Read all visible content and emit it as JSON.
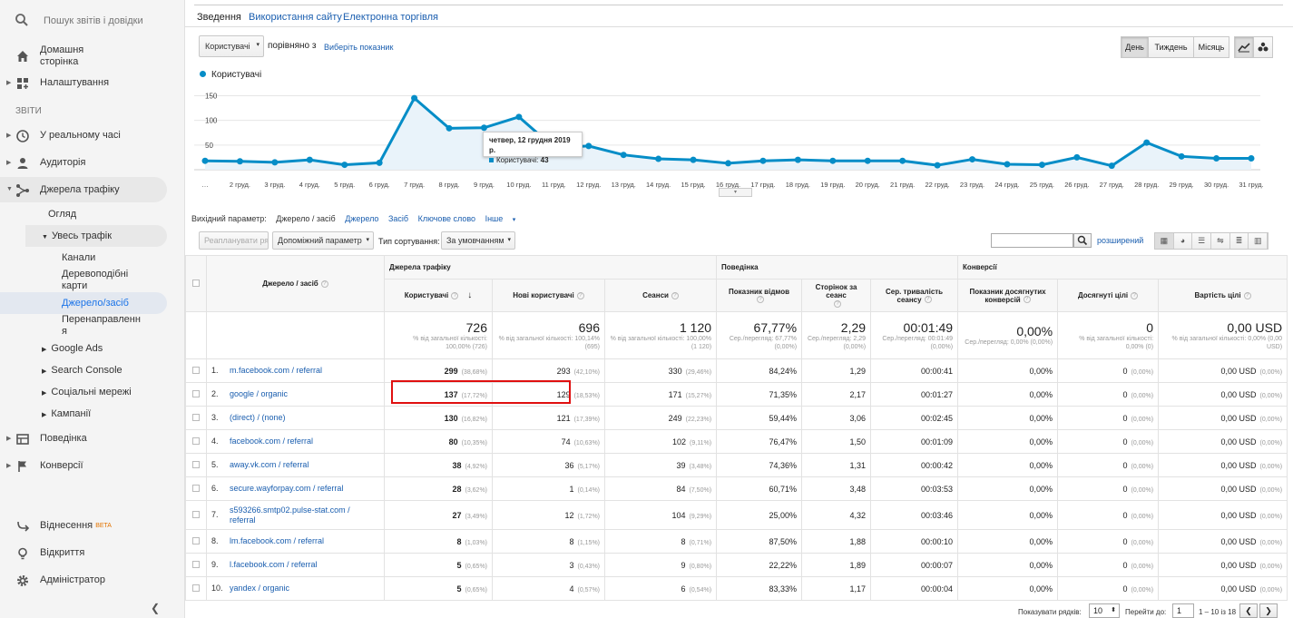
{
  "sidebar": {
    "search_placeholder": "Пошук звітів і довідки",
    "home": "Домашня сторінка",
    "settings": "Налаштування",
    "section_reports": "ЗВІТИ",
    "realtime": "У реальному часі",
    "audience": "Аудиторія",
    "acquisition": "Джерела трафіку",
    "overview": "Огляд",
    "all_traffic": "Увесь трафік",
    "channels": "Канали",
    "treemaps": "Деревоподібні карти",
    "source_medium": "Джерело/засіб",
    "referrals": "Перенаправлення",
    "google_ads": "Google Ads",
    "search_console": "Search Console",
    "social": "Соціальні мережі",
    "campaigns": "Кампанії",
    "behavior": "Поведінка",
    "conversions": "Конверсії",
    "attribution": "Віднесення",
    "beta": "BETA",
    "discover": "Відкриття",
    "admin": "Адміністратор"
  },
  "tabs": [
    "Зведення",
    "Використання сайту",
    "Електронна торгівля"
  ],
  "controls": {
    "metric": "Користувачі",
    "compare": "порівняно з",
    "select_metric": "Виберіть показник",
    "day": "День",
    "week": "Тиждень",
    "month": "Місяць"
  },
  "chart_data": {
    "type": "line",
    "series": [
      {
        "name": "Користувачі",
        "values": [
          18,
          17,
          15,
          20,
          10,
          14,
          145,
          84,
          85,
          107,
          45,
          48,
          30,
          22,
          20,
          13,
          18,
          20,
          18,
          18,
          18,
          9,
          21,
          11,
          10,
          25,
          8,
          55,
          27,
          23,
          23
        ]
      }
    ],
    "categories": [
      "…",
      "2 груд.",
      "3 груд.",
      "4 груд.",
      "5 груд.",
      "6 груд.",
      "7 груд.",
      "8 груд.",
      "9 груд.",
      "10 груд.",
      "11 груд.",
      "12 груд.",
      "13 груд.",
      "14 груд.",
      "15 груд.",
      "16 груд.",
      "17 груд.",
      "18 груд.",
      "19 груд.",
      "20 груд.",
      "21 груд.",
      "22 груд.",
      "23 груд.",
      "24 груд.",
      "25 груд.",
      "26 груд.",
      "27 груд.",
      "28 груд.",
      "29 груд.",
      "30 груд.",
      "31 груд."
    ],
    "yticks": [
      "150",
      "100",
      "50"
    ],
    "ylim": [
      0,
      160
    ],
    "color": "#058dc7",
    "tooltip_title": "четвер, 12 грудня 2019 р.",
    "tooltip_label": "Користувачі:",
    "tooltip_value": "43"
  },
  "dims": {
    "label": "Вихідний параметр:",
    "current": "Джерело / засіб",
    "source": "Джерело",
    "medium": "Засіб",
    "keyword": "Ключове слово",
    "other": "Інше"
  },
  "toolbar": {
    "plot_rows": "Реапланувати ряди",
    "secondary": "Допоміжний параметр",
    "sort_type": "Тип сортування:",
    "sort_default": "За умовчанням",
    "advanced": "розширений"
  },
  "table": {
    "groups": [
      "Джерела трафіку",
      "Поведінка",
      "Конверсії"
    ],
    "dim_header": "Джерело / засіб",
    "cols": [
      "Користувачі",
      "Нові користувачі",
      "Сеанси",
      "Показник відмов",
      "Сторінок за сеанс",
      "Сер. тривалість сеансу",
      "Показник досягнутих конверсій",
      "Досягнуті цілі",
      "Вартість цілі"
    ],
    "totals": [
      {
        "v": "726",
        "s": "% від загальної кількості: 100,00% (726)"
      },
      {
        "v": "696",
        "s": "% від загальної кількості: 100,14% (695)"
      },
      {
        "v": "1 120",
        "s": "% від загальної кількості: 100,00% (1 120)"
      },
      {
        "v": "67,77%",
        "s": "Сер./перегляд: 67,77% (0,00%)"
      },
      {
        "v": "2,29",
        "s": "Сер./перегляд: 2,29 (0,00%)"
      },
      {
        "v": "00:01:49",
        "s": "Сер./перегляд: 00:01:49 (0,00%)"
      },
      {
        "v": "0,00%",
        "s": "Сер./перегляд: 0,00% (0,00%)"
      },
      {
        "v": "0",
        "s": "% від загальної кількості: 0,00% (0)"
      },
      {
        "v": "0,00 USD",
        "s": "% від загальної кількості: 0,00% (0,00 USD)"
      }
    ],
    "rows": [
      {
        "n": "1.",
        "src": "m.facebook.com / referral",
        "u": "299",
        "up": "(38,68%)",
        "nu": "293",
        "nup": "(42,10%)",
        "s": "330",
        "sp": "(29,46%)",
        "br": "84,24%",
        "pps": "1,29",
        "dur": "00:00:41",
        "cr": "0,00%",
        "g": "0",
        "gp": "(0,00%)",
        "gv": "0,00 USD",
        "gvp": "(0,00%)"
      },
      {
        "n": "2.",
        "src": "google / organic",
        "u": "137",
        "up": "(17,72%)",
        "nu": "129",
        "nup": "(18,53%)",
        "s": "171",
        "sp": "(15,27%)",
        "br": "71,35%",
        "pps": "2,17",
        "dur": "00:01:27",
        "cr": "0,00%",
        "g": "0",
        "gp": "(0,00%)",
        "gv": "0,00 USD",
        "gvp": "(0,00%)"
      },
      {
        "n": "3.",
        "src": "(direct) / (none)",
        "u": "130",
        "up": "(16,82%)",
        "nu": "121",
        "nup": "(17,39%)",
        "s": "249",
        "sp": "(22,23%)",
        "br": "59,44%",
        "pps": "3,06",
        "dur": "00:02:45",
        "cr": "0,00%",
        "g": "0",
        "gp": "(0,00%)",
        "gv": "0,00 USD",
        "gvp": "(0,00%)"
      },
      {
        "n": "4.",
        "src": "facebook.com / referral",
        "u": "80",
        "up": "(10,35%)",
        "nu": "74",
        "nup": "(10,63%)",
        "s": "102",
        "sp": "(9,11%)",
        "br": "76,47%",
        "pps": "1,50",
        "dur": "00:01:09",
        "cr": "0,00%",
        "g": "0",
        "gp": "(0,00%)",
        "gv": "0,00 USD",
        "gvp": "(0,00%)"
      },
      {
        "n": "5.",
        "src": "away.vk.com / referral",
        "u": "38",
        "up": "(4,92%)",
        "nu": "36",
        "nup": "(5,17%)",
        "s": "39",
        "sp": "(3,48%)",
        "br": "74,36%",
        "pps": "1,31",
        "dur": "00:00:42",
        "cr": "0,00%",
        "g": "0",
        "gp": "(0,00%)",
        "gv": "0,00 USD",
        "gvp": "(0,00%)"
      },
      {
        "n": "6.",
        "src": "secure.wayforpay.com / referral",
        "u": "28",
        "up": "(3,62%)",
        "nu": "1",
        "nup": "(0,14%)",
        "s": "84",
        "sp": "(7,50%)",
        "br": "60,71%",
        "pps": "3,48",
        "dur": "00:03:53",
        "cr": "0,00%",
        "g": "0",
        "gp": "(0,00%)",
        "gv": "0,00 USD",
        "gvp": "(0,00%)"
      },
      {
        "n": "7.",
        "src": "s593266.smtp02.pulse-stat.com / referral",
        "u": "27",
        "up": "(3,49%)",
        "nu": "12",
        "nup": "(1,72%)",
        "s": "104",
        "sp": "(9,29%)",
        "br": "25,00%",
        "pps": "4,32",
        "dur": "00:03:46",
        "cr": "0,00%",
        "g": "0",
        "gp": "(0,00%)",
        "gv": "0,00 USD",
        "gvp": "(0,00%)"
      },
      {
        "n": "8.",
        "src": "lm.facebook.com / referral",
        "u": "8",
        "up": "(1,03%)",
        "nu": "8",
        "nup": "(1,15%)",
        "s": "8",
        "sp": "(0,71%)",
        "br": "87,50%",
        "pps": "1,88",
        "dur": "00:00:10",
        "cr": "0,00%",
        "g": "0",
        "gp": "(0,00%)",
        "gv": "0,00 USD",
        "gvp": "(0,00%)"
      },
      {
        "n": "9.",
        "src": "l.facebook.com / referral",
        "u": "5",
        "up": "(0,65%)",
        "nu": "3",
        "nup": "(0,43%)",
        "s": "9",
        "sp": "(0,80%)",
        "br": "22,22%",
        "pps": "1,89",
        "dur": "00:00:07",
        "cr": "0,00%",
        "g": "0",
        "gp": "(0,00%)",
        "gv": "0,00 USD",
        "gvp": "(0,00%)"
      },
      {
        "n": "10.",
        "src": "yandex / organic",
        "u": "5",
        "up": "(0,65%)",
        "nu": "4",
        "nup": "(0,57%)",
        "s": "6",
        "sp": "(0,54%)",
        "br": "83,33%",
        "pps": "1,17",
        "dur": "00:00:04",
        "cr": "0,00%",
        "g": "0",
        "gp": "(0,00%)",
        "gv": "0,00 USD",
        "gvp": "(0,00%)"
      }
    ]
  },
  "pager": {
    "show_rows": "Показувати рядків:",
    "rows_value": "10",
    "goto": "Перейти до:",
    "goto_value": "1",
    "range": "1 – 10 із 18"
  }
}
